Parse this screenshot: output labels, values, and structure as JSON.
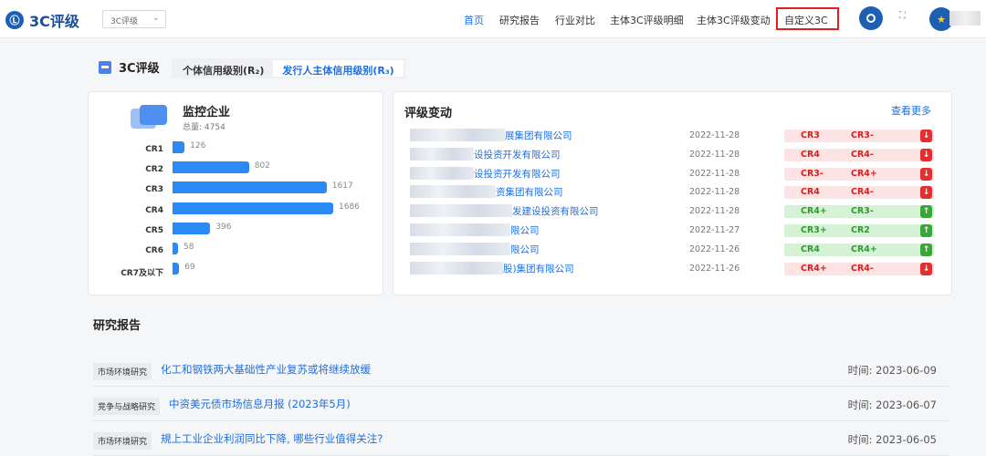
{
  "header": {
    "logo_mark": "Ⓛ",
    "logo_text": "3C评级",
    "selector": "3C评级",
    "nav": [
      "首页",
      "研究报告",
      "行业对比",
      "主体3C评级明细",
      "主体3C评级变动",
      "自定义3C"
    ]
  },
  "section": {
    "title": "3C评级",
    "tabs": [
      "个体信用级别(R₂)",
      "发行人主体信用级别(R₃)"
    ],
    "active_tab": 1
  },
  "monitor": {
    "title": "监控企业",
    "total": "总量: 4754",
    "bars": [
      {
        "label": "CR1",
        "value": 126
      },
      {
        "label": "CR2",
        "value": 802
      },
      {
        "label": "CR3",
        "value": 1617
      },
      {
        "label": "CR4",
        "value": 1686
      },
      {
        "label": "CR5",
        "value": 396
      },
      {
        "label": "CR6",
        "value": 58
      },
      {
        "label": "CR7及以下",
        "value": 69
      }
    ]
  },
  "rating_changes": {
    "title": "评级变动",
    "more": "查看更多",
    "rows": [
      {
        "name": "展集团有限公司",
        "date": "2022-11-28",
        "from": "CR3",
        "to": "CR3-",
        "dir": "down"
      },
      {
        "name": "设投资开发有限公司",
        "date": "2022-11-28",
        "from": "CR4",
        "to": "CR4-",
        "dir": "down"
      },
      {
        "name": "设投资开发有限公司",
        "date": "2022-11-28",
        "from": "CR3-",
        "to": "CR4+",
        "dir": "down"
      },
      {
        "name": "资集团有限公司",
        "date": "2022-11-28",
        "from": "CR4",
        "to": "CR4-",
        "dir": "down"
      },
      {
        "name": "发建设投资有限公司",
        "date": "2022-11-28",
        "from": "CR4+",
        "to": "CR3-",
        "dir": "up"
      },
      {
        "name": "限公司",
        "date": "2022-11-27",
        "from": "CR3+",
        "to": "CR2",
        "dir": "up"
      },
      {
        "name": "限公司",
        "date": "2022-11-26",
        "from": "CR4",
        "to": "CR4+",
        "dir": "up"
      },
      {
        "name": "股)集团有限公司",
        "date": "2022-11-26",
        "from": "CR4+",
        "to": "CR4-",
        "dir": "down"
      }
    ]
  },
  "reports": {
    "title": "研究报告",
    "items": [
      {
        "tag": "市场环境研究",
        "title": "化工和钢铁两大基础性产业复苏或将继续放缓",
        "time": "时间: 2023-06-09"
      },
      {
        "tag": "竞争与战略研究",
        "title": "中资美元债市场信息月报 (2023年5月)",
        "time": "时间: 2023-06-07"
      },
      {
        "tag": "市场环境研究",
        "title": "規上工业企业利润同比下降, 哪些行业值得关注?",
        "time": "时间: 2023-06-05"
      }
    ]
  }
}
